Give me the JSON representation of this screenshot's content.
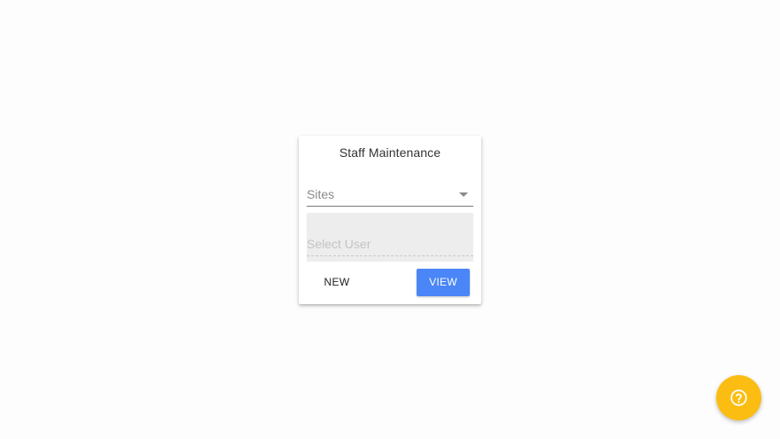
{
  "card": {
    "title": "Staff Maintenance",
    "sites_select": {
      "placeholder": "Sites"
    },
    "user_select": {
      "placeholder": "Select User"
    },
    "new_button_label": "NEW",
    "view_button_label": "VIEW"
  },
  "fab": {
    "icon": "help-circle-icon"
  },
  "colors": {
    "primary": "#4a86f7",
    "fab": "#fbbd12",
    "background": "#fdfdfd"
  }
}
